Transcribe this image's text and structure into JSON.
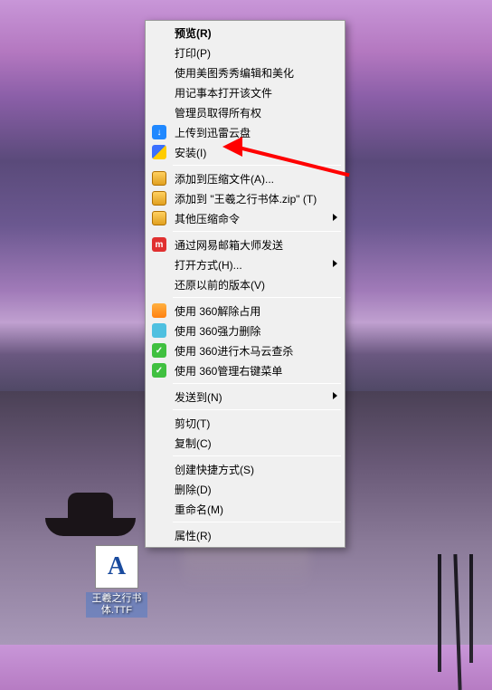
{
  "desktop": {
    "file_label": "王羲之行书体.TTF",
    "file_glyph": "A"
  },
  "menu": {
    "items": [
      {
        "label": "预览(R)",
        "bold": true
      },
      {
        "label": "打印(P)"
      },
      {
        "label": "使用美图秀秀编辑和美化"
      },
      {
        "label": "用记事本打开该文件"
      },
      {
        "label": "管理员取得所有权"
      },
      {
        "label": "上传到迅雷云盘",
        "icon": "xunlei-icon",
        "iconClass": "ic-blue",
        "iconText": "↓"
      },
      {
        "label": "安装(I)",
        "icon": "shield-icon",
        "iconClass": "ic-shield"
      },
      {
        "sep": true
      },
      {
        "label": "添加到压缩文件(A)...",
        "icon": "archive-icon",
        "iconClass": "ic-archive"
      },
      {
        "label": "添加到 \"王羲之行书体.zip\" (T)",
        "icon": "archive-icon",
        "iconClass": "ic-archive"
      },
      {
        "label": "其他压缩命令",
        "icon": "archive-icon",
        "iconClass": "ic-archive",
        "submenu": true
      },
      {
        "sep": true
      },
      {
        "label": "通过网易邮箱大师发送",
        "icon": "netease-icon",
        "iconClass": "ic-red",
        "iconText": "m"
      },
      {
        "label": "打开方式(H)...",
        "submenu": true
      },
      {
        "label": "还原以前的版本(V)"
      },
      {
        "sep": true
      },
      {
        "label": "使用 360解除占用",
        "icon": "unlock-icon",
        "iconClass": "ic-orange"
      },
      {
        "label": "使用 360强力删除",
        "icon": "shred-icon",
        "iconClass": "ic-cyan"
      },
      {
        "label": "使用 360进行木马云查杀",
        "icon": "360-icon",
        "iconClass": "ic-green",
        "iconText": "✓"
      },
      {
        "label": "使用 360管理右键菜单",
        "icon": "360-icon",
        "iconClass": "ic-green",
        "iconText": "✓"
      },
      {
        "sep": true
      },
      {
        "label": "发送到(N)",
        "submenu": true
      },
      {
        "sep": true
      },
      {
        "label": "剪切(T)"
      },
      {
        "label": "复制(C)"
      },
      {
        "sep": true
      },
      {
        "label": "创建快捷方式(S)"
      },
      {
        "label": "删除(D)"
      },
      {
        "label": "重命名(M)"
      },
      {
        "sep": true
      },
      {
        "label": "属性(R)"
      }
    ]
  },
  "arrow": {
    "target": "安装(I)"
  }
}
